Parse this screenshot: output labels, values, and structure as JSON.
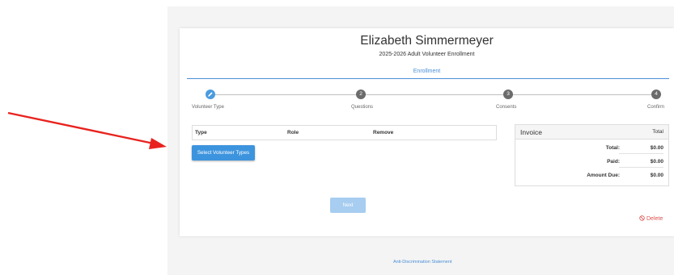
{
  "header": {
    "name": "Elizabeth Simmermeyer",
    "subtitle": "2025-2026 Adult Volunteer Enrollment",
    "tab": "Enrollment"
  },
  "steps": [
    {
      "number": "",
      "label": "Volunteer Type",
      "status": "complete",
      "icon": "pencil-icon"
    },
    {
      "number": "2",
      "label": "Questions",
      "status": "pending"
    },
    {
      "number": "3",
      "label": "Consents",
      "status": "pending"
    },
    {
      "number": "4",
      "label": "Confirm",
      "status": "pending"
    }
  ],
  "volunteer_table": {
    "columns": [
      "Type",
      "Role",
      "Remove"
    ],
    "select_button": "Select Volunteer Types"
  },
  "invoice": {
    "title": "Invoice",
    "total_header": "Total",
    "rows": [
      {
        "label": "Total:",
        "value": "$0.00"
      },
      {
        "label": "Paid:",
        "value": "$0.00"
      },
      {
        "label": "Amount Due:",
        "value": "$0.00"
      }
    ]
  },
  "actions": {
    "next": "Next",
    "delete": "Delete"
  },
  "footer": {
    "link": "Anti-Discrimination Statement"
  },
  "colors": {
    "accent": "#4a8fd6",
    "primary_button": "#3d94de",
    "disabled_button": "#a7cdf0",
    "danger": "#d9534f",
    "annotation_arrow": "#e8231f"
  }
}
